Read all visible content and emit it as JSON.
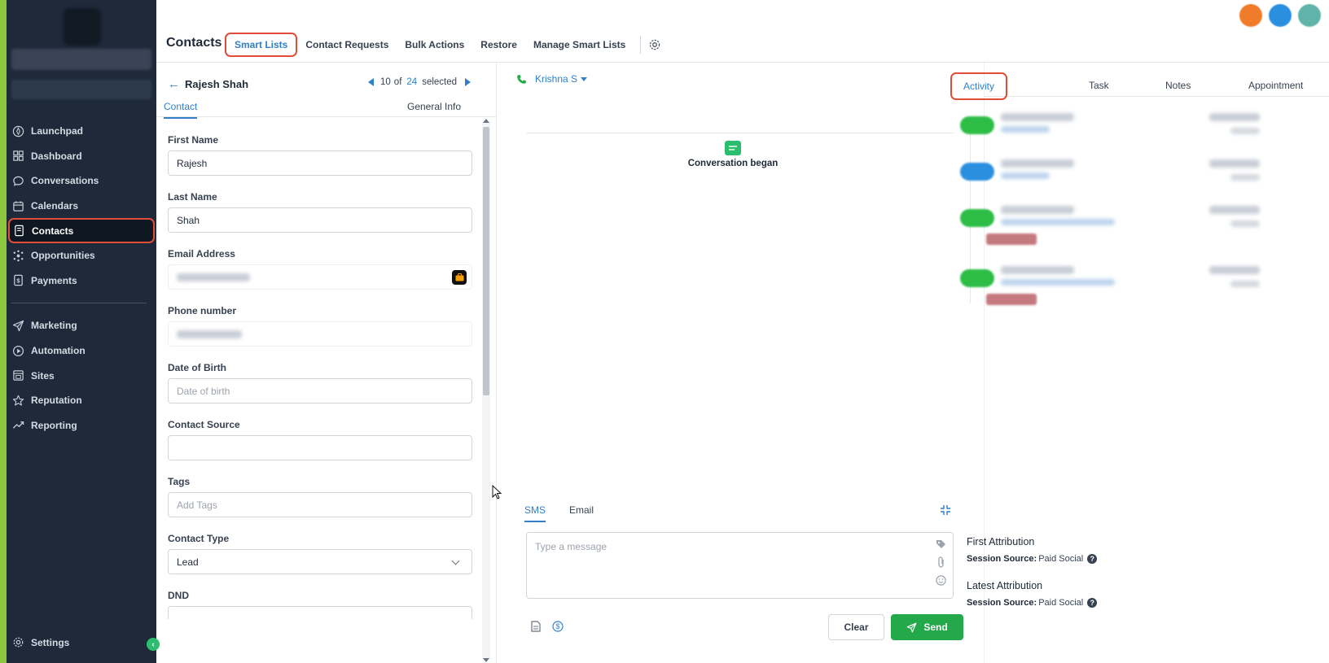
{
  "colors": {
    "accent": "#2f80c8",
    "sidebar_bg": "#1e2a3a",
    "highlight": "#e04e39",
    "send": "#23a94a",
    "brand_edge": "#8cc63f"
  },
  "sidebar": {
    "items": [
      {
        "label": "Launchpad",
        "icon": "rocket-icon"
      },
      {
        "label": "Dashboard",
        "icon": "grid-icon"
      },
      {
        "label": "Conversations",
        "icon": "chat-icon"
      },
      {
        "label": "Calendars",
        "icon": "calendar-icon"
      },
      {
        "label": "Contacts",
        "icon": "contacts-icon",
        "active": true
      },
      {
        "label": "Opportunities",
        "icon": "opportunities-icon"
      },
      {
        "label": "Payments",
        "icon": "payments-icon"
      },
      {
        "label": "Marketing",
        "icon": "send-icon"
      },
      {
        "label": "Automation",
        "icon": "automation-icon"
      },
      {
        "label": "Sites",
        "icon": "sites-icon"
      },
      {
        "label": "Reputation",
        "icon": "star-icon"
      },
      {
        "label": "Reporting",
        "icon": "trend-icon"
      }
    ],
    "settings_label": "Settings"
  },
  "topbar": {
    "title": "Contacts",
    "tabs": [
      {
        "label": "Smart Lists",
        "active": true
      },
      {
        "label": "Contact Requests"
      },
      {
        "label": "Bulk Actions"
      },
      {
        "label": "Restore"
      },
      {
        "label": "Manage Smart Lists"
      }
    ]
  },
  "contact": {
    "name": "Rajesh Shah",
    "pager": {
      "current": "10",
      "of_label": "of",
      "total": "24",
      "suffix": "selected"
    },
    "tabs": {
      "contact": "Contact",
      "general": "General Info"
    },
    "fields": {
      "first_name": {
        "label": "First Name",
        "value": "Rajesh"
      },
      "last_name": {
        "label": "Last Name",
        "value": "Shah"
      },
      "email": {
        "label": "Email Address"
      },
      "phone": {
        "label": "Phone number"
      },
      "dob": {
        "label": "Date of Birth",
        "placeholder": "Date of birth"
      },
      "source": {
        "label": "Contact Source",
        "value": ""
      },
      "tags": {
        "label": "Tags",
        "placeholder": "Add Tags"
      },
      "type": {
        "label": "Contact Type",
        "value": "Lead"
      },
      "dnd": {
        "label": "DND"
      }
    }
  },
  "conversation": {
    "assignee": "Krishna S",
    "began_label": "Conversation began",
    "tabs": {
      "sms": "SMS",
      "email": "Email"
    },
    "input_placeholder": "Type a message",
    "clear_label": "Clear",
    "send_label": "Send"
  },
  "activity": {
    "tabs": {
      "activity": "Activity",
      "task": "Task",
      "notes": "Notes",
      "appointment": "Appointment"
    },
    "first_attribution": {
      "title": "First Attribution",
      "key": "Session Source:",
      "value": "Paid Social"
    },
    "latest_attribution": {
      "title": "Latest Attribution",
      "key": "Session Source:",
      "value": "Paid Social"
    }
  }
}
